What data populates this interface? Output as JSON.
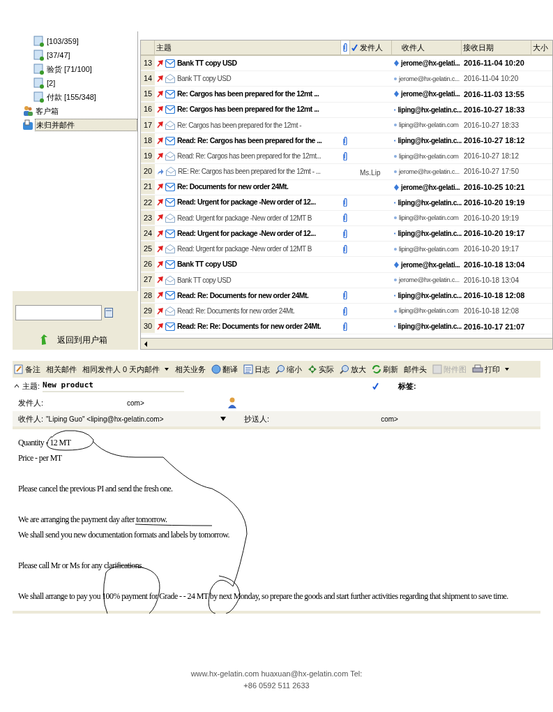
{
  "folders": [
    {
      "label": "[103/359]",
      "kind": "folder"
    },
    {
      "label": "[37/47]",
      "kind": "folder"
    },
    {
      "label": "验货 [71/100]",
      "kind": "folder"
    },
    {
      "label": "[2]",
      "kind": "folder"
    },
    {
      "label": "付款 [155/348]",
      "kind": "folder"
    },
    {
      "label": "客户箱",
      "kind": "contacts",
      "selected": false
    },
    {
      "label": "未归并邮件",
      "kind": "inbox",
      "selected": true
    }
  ],
  "return_button": "返回到用户箱",
  "table": {
    "columns": {
      "subject": "主题",
      "sender": "发件人",
      "recipient": "收件人",
      "date": "接收日期",
      "size": "大小"
    },
    "rows": [
      {
        "num": "13",
        "forwarded": false,
        "unread": true,
        "attachment": false,
        "subject": "Bank TT copy USD",
        "recipient": "jerome@hx-gelati...",
        "date": "2016-11-04 10:20"
      },
      {
        "num": "14",
        "forwarded": false,
        "unread": false,
        "attachment": false,
        "subject": "Bank TT copy USD",
        "recipient": "jerome@hx-gelatin.c...",
        "date": "2016-11-04 10:20"
      },
      {
        "num": "15",
        "forwarded": false,
        "unread": true,
        "attachment": false,
        "subject": "Re: Cargos has been prepared for the 12mt ...",
        "recipient": "jerome@hx-gelati...",
        "date": "2016-11-03 13:55"
      },
      {
        "num": "16",
        "forwarded": false,
        "unread": true,
        "attachment": false,
        "subject": "Re: Cargos has been prepared for the 12mt ...",
        "recipient": "liping@hx-gelatin.c...",
        "date": "2016-10-27 18:33"
      },
      {
        "num": "17",
        "forwarded": false,
        "unread": false,
        "attachment": false,
        "subject": "Re: Cargos has been prepared for the 12mt -",
        "recipient": "liping@hx-gelatin.com",
        "date": "2016-10-27 18:33"
      },
      {
        "num": "18",
        "forwarded": false,
        "unread": true,
        "attachment": true,
        "subject": "Read: Re: Cargos has been prepared for the ...",
        "recipient": "liping@hx-gelatin.c...",
        "date": "2016-10-27 18:12"
      },
      {
        "num": "19",
        "forwarded": false,
        "unread": false,
        "attachment": true,
        "subject": "Read: Re: Cargos has been prepared for the 12mt...",
        "recipient": "liping@hx-gelatin.com",
        "date": "2016-10-27 18:12"
      },
      {
        "num": "20",
        "forwarded": true,
        "unread": false,
        "attachment": false,
        "subject": "RE: Re: Cargos has been prepared for the 12mt - ...",
        "sender": "Ms.Lip",
        "recipient": "jerome@hx-gelatin.c...",
        "date": "2016-10-27 17:50"
      },
      {
        "num": "21",
        "forwarded": false,
        "unread": true,
        "attachment": false,
        "subject": "Re: Documents for new order 24Mt.",
        "recipient": "jerome@hx-gelati...",
        "date": "2016-10-25 10:21"
      },
      {
        "num": "22",
        "forwarded": false,
        "unread": true,
        "attachment": true,
        "subject": "Read: Urgent for package -New order of 12...",
        "recipient": "liping@hx-gelatin.c...",
        "date": "2016-10-20 19:19"
      },
      {
        "num": "23",
        "forwarded": false,
        "unread": false,
        "attachment": true,
        "subject": "Read: Urgent for package -New order of 12MT B",
        "recipient": "liping@hx-gelatin.com",
        "date": "2016-10-20 19:19"
      },
      {
        "num": "24",
        "forwarded": false,
        "unread": true,
        "attachment": true,
        "subject": "Read: Urgent for package -New order of 12...",
        "recipient": "liping@hx-gelatin.c...",
        "date": "2016-10-20 19:17"
      },
      {
        "num": "25",
        "forwarded": false,
        "unread": false,
        "attachment": true,
        "subject": "Read: Urgent for package -New order of 12MT B",
        "recipient": "liping@hx-gelatin.com",
        "date": "2016-10-20 19:17"
      },
      {
        "num": "26",
        "forwarded": false,
        "unread": true,
        "attachment": false,
        "subject": "Bank TT copy USD",
        "recipient": "jerome@hx-gelati...",
        "date": "2016-10-18 13:04"
      },
      {
        "num": "27",
        "forwarded": false,
        "unread": false,
        "attachment": false,
        "subject": "Bank TT copy USD",
        "recipient": "jerome@hx-gelatin.c...",
        "date": "2016-10-18 13:04"
      },
      {
        "num": "28",
        "forwarded": false,
        "unread": true,
        "attachment": true,
        "subject": "Read: Re: Documents for new order 24Mt.",
        "recipient": "liping@hx-gelatin.c...",
        "date": "2016-10-18 12:08"
      },
      {
        "num": "29",
        "forwarded": false,
        "unread": false,
        "attachment": true,
        "subject": "Read: Re: Documents for new order 24Mt.",
        "recipient": "liping@hx-gelatin.com",
        "date": "2016-10-18 12:08"
      },
      {
        "num": "30",
        "forwarded": false,
        "unread": true,
        "attachment": true,
        "subject": "Read: Re: Re: Documents for new order 24Mt.",
        "recipient": "liping@hx-gelatin.c...",
        "date": "2016-10-17 21:07"
      }
    ]
  },
  "toolbar": [
    {
      "label": "备注",
      "dropdown": false,
      "disabled": false
    },
    {
      "label": "相关邮件",
      "dropdown": false,
      "disabled": false
    },
    {
      "label": "相同发件人 0 天内邮件",
      "dropdown": true,
      "disabled": false
    },
    {
      "label": "相关业务",
      "dropdown": false,
      "disabled": false
    },
    {
      "label": "翻译",
      "dropdown": false,
      "disabled": false
    },
    {
      "label": "日志",
      "dropdown": false,
      "disabled": false
    },
    {
      "label": "缩小",
      "dropdown": false,
      "disabled": false
    },
    {
      "label": "实际",
      "dropdown": false,
      "disabled": false
    },
    {
      "label": "放大",
      "dropdown": false,
      "disabled": false
    },
    {
      "label": "刷新",
      "dropdown": false,
      "disabled": false
    },
    {
      "label": "邮件头",
      "dropdown": false,
      "disabled": false
    },
    {
      "label": "附件图",
      "dropdown": false,
      "disabled": true
    },
    {
      "label": "打印",
      "dropdown": true,
      "disabled": false
    }
  ],
  "message": {
    "subject_label": "主题:",
    "subject": "New product",
    "tags_label": "标签:",
    "from_label": "发件人:",
    "from": "com>",
    "to_label": "收件人:",
    "to": "\"Liping Guo\" <liping@hx-gelatin.com>",
    "cc_label": "抄送人:",
    "cc": "com>",
    "body": [
      [
        "Quantity - 12 MT",
        "Price - per MT"
      ],
      [
        "Please cancel the previous PI and send the fresh one."
      ],
      [
        "We are arranging the payment day after tomorrow.",
        "We shall send you new documentation formats and labels by tomorrow."
      ],
      [
        "Please call Mr or Ms for any clarifications."
      ],
      [
        "We shall arrange to pay you 100% payment  for Grade - - 24 MT by next Monday, so prepare the goods and start further activities regarding that shipment to save time."
      ]
    ]
  },
  "footer": [
    "www.hx-gelatin.com huaxuan@hx-gelatin.com Tel:",
    "+86 0592 511 2633"
  ]
}
